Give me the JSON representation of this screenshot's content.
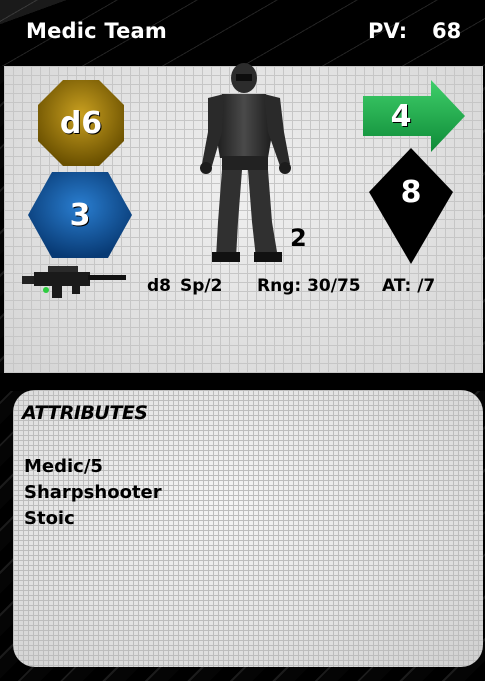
{
  "card": {
    "unit_name": "Medic Team",
    "pv_label": "PV:",
    "pv_value": "68"
  },
  "stats": {
    "skill": {
      "value": "d6",
      "color": "#8b6b00"
    },
    "armor": {
      "value": "3",
      "color": "#0b4f96"
    },
    "move": {
      "value": "4",
      "color": "#1fa84a"
    },
    "defense": {
      "value": "8",
      "color": "#000000"
    },
    "model_count": "2"
  },
  "weapon": {
    "icon": "rifle-icon",
    "die": "d8",
    "special": "Sp/2",
    "range": "Rng: 30/75",
    "armor_penetration": "AT: /7"
  },
  "attributes": {
    "title": "ATTRIBUTES",
    "items": [
      "Medic/5",
      "Sharpshooter",
      "Stoic"
    ]
  }
}
